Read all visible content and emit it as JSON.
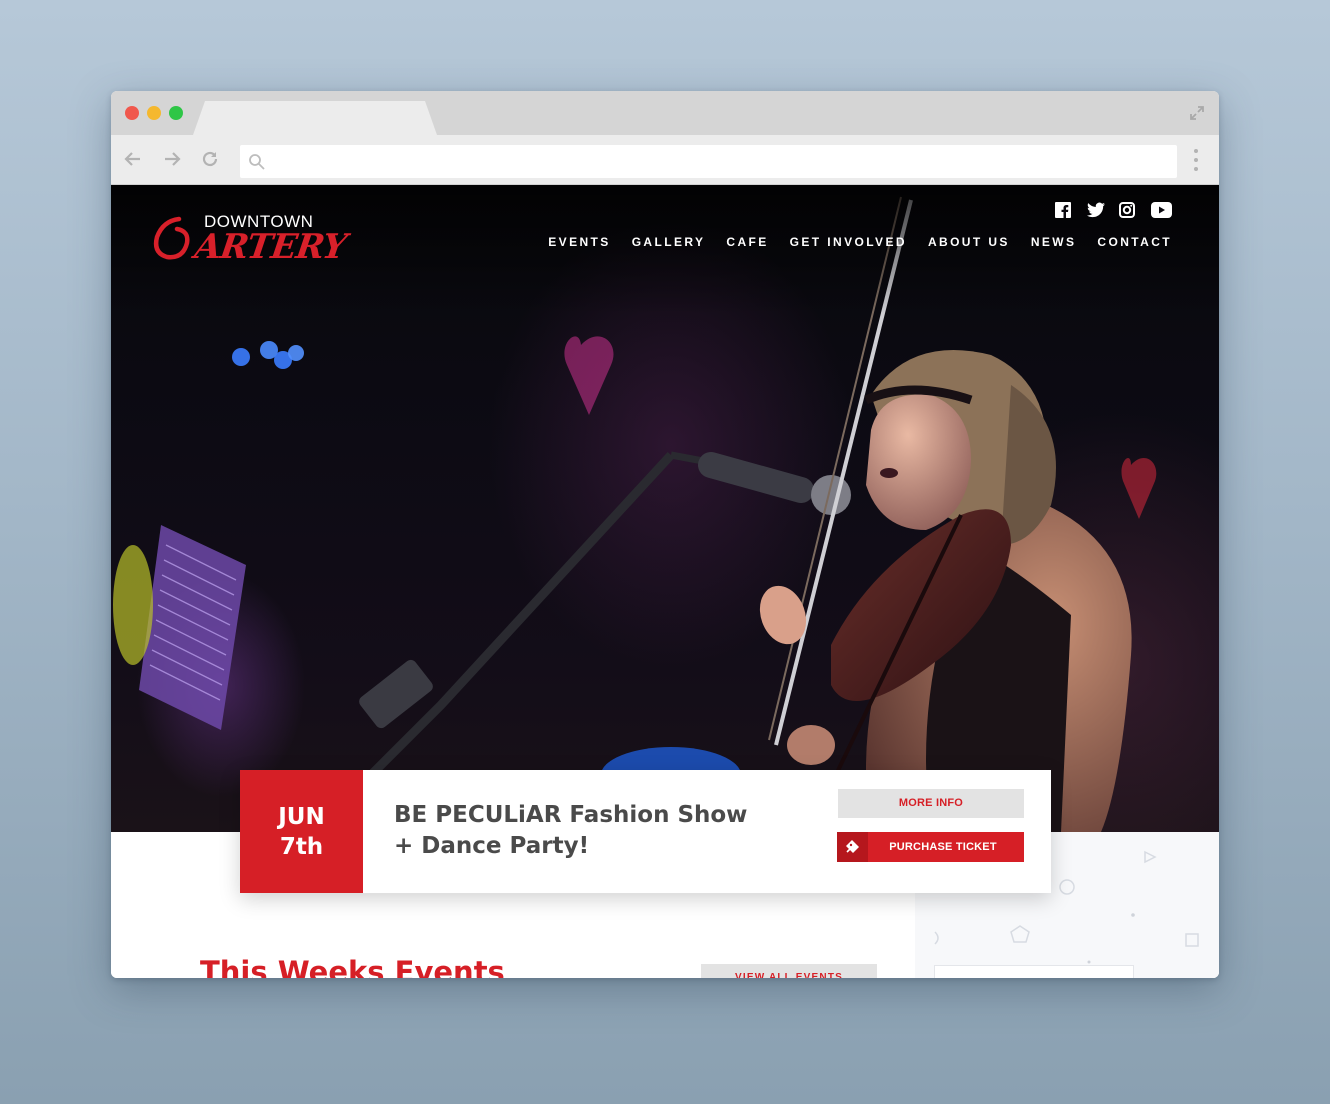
{
  "browser": {
    "url_value": "",
    "tab_title": ""
  },
  "site": {
    "logo": {
      "top_word": "DOWNTOWN",
      "main_word": "ARTERY"
    },
    "social_icons": [
      "facebook-icon",
      "twitter-icon",
      "instagram-icon",
      "youtube-icon"
    ],
    "nav": [
      {
        "label": "EVENTS"
      },
      {
        "label": "GALLERY"
      },
      {
        "label": "CAFE"
      },
      {
        "label": "GET INVOLVED"
      },
      {
        "label": "ABOUT US"
      },
      {
        "label": "NEWS"
      },
      {
        "label": "CONTACT"
      }
    ]
  },
  "featured_event": {
    "month": "JUN",
    "day": "7th",
    "title": "BE PECULiAR Fashion Show + Dance Party!",
    "more_info_label": "MORE INFO",
    "purchase_label": "PURCHASE TICKET"
  },
  "events_section": {
    "title": "This Weeks Events",
    "view_all_label": "VIEW ALL EVENTS"
  },
  "colors": {
    "brand_red": "#d61f26",
    "dark_red": "#b5171d",
    "text_gray": "#4a4a4a",
    "button_gray": "#e3e3e3"
  }
}
